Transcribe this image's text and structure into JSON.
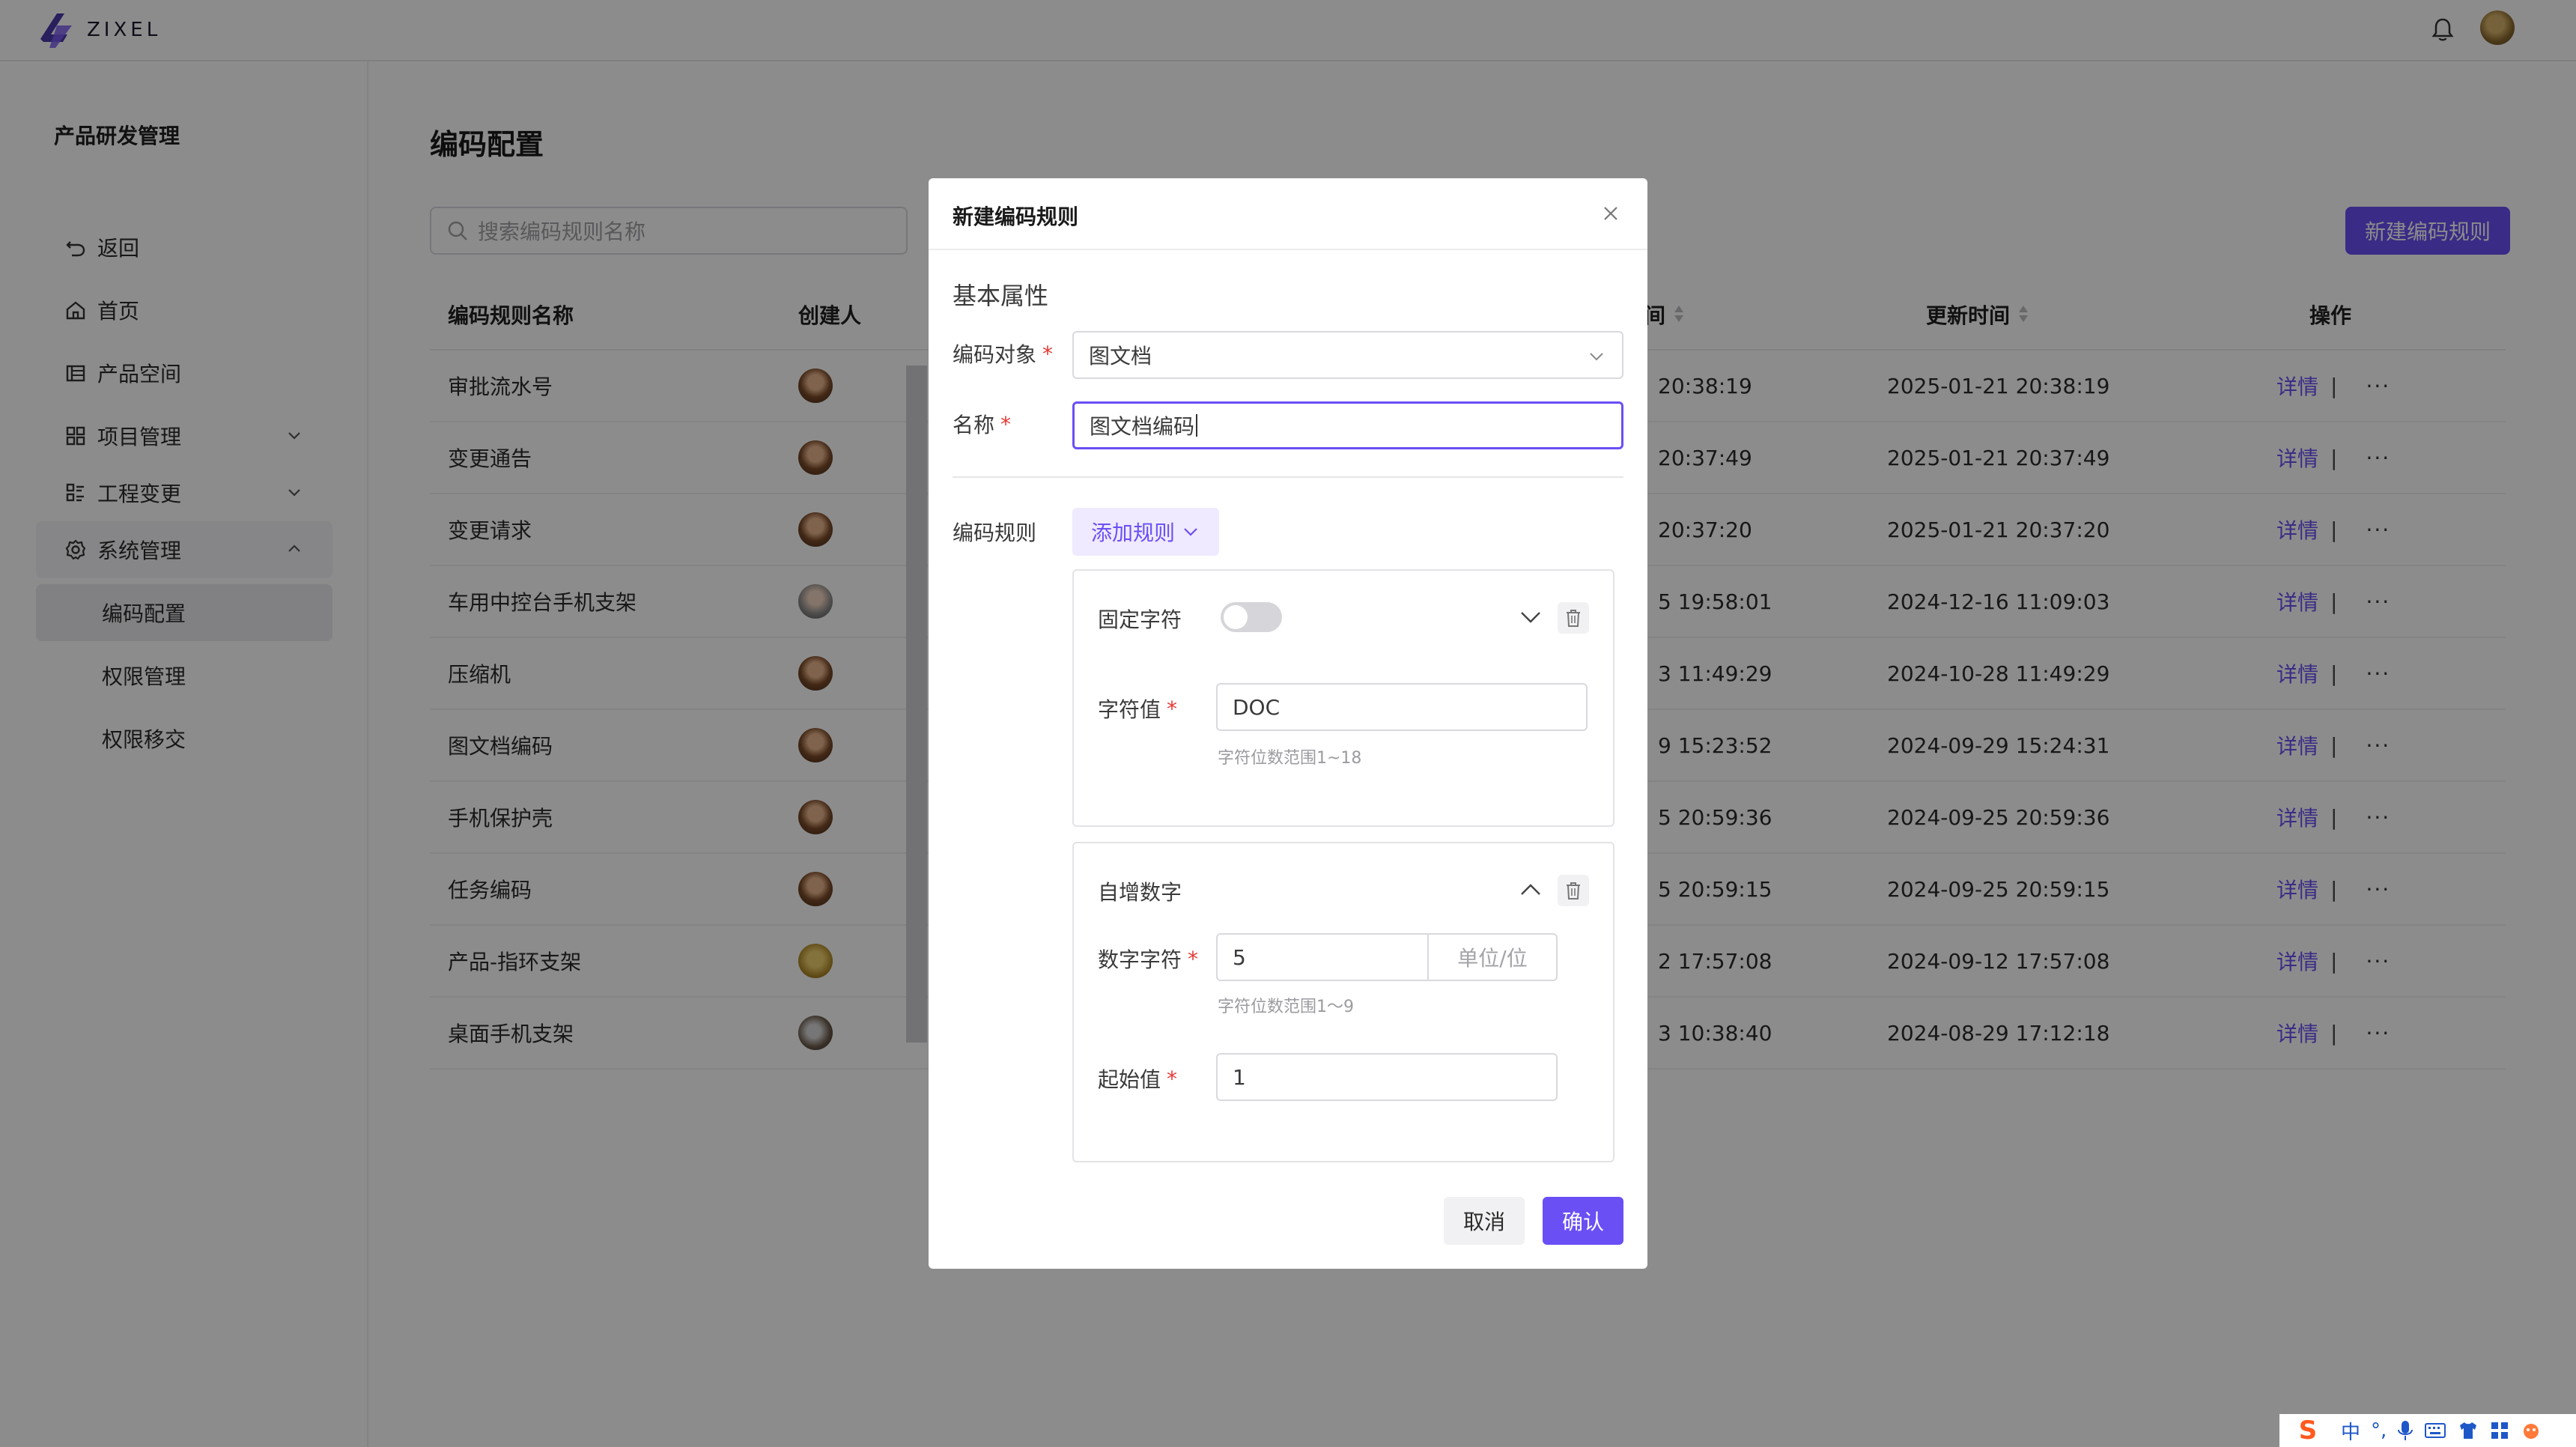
{
  "app": {
    "brand": "ZIXEL"
  },
  "sidebar": {
    "title": "产品研发管理",
    "items": [
      {
        "label": "返回",
        "icon": "undo-icon"
      },
      {
        "label": "首页",
        "icon": "home-icon"
      },
      {
        "label": "产品空间",
        "icon": "library-icon"
      },
      {
        "label": "项目管理",
        "icon": "grid-icon"
      },
      {
        "label": "工程变更",
        "icon": "list-icon"
      },
      {
        "label": "系统管理",
        "icon": "gear-icon"
      }
    ],
    "sub_items": [
      {
        "label": "编码配置"
      },
      {
        "label": "权限管理"
      },
      {
        "label": "权限移交"
      }
    ]
  },
  "main": {
    "title": "编码配置",
    "search_placeholder": "搜索编码规则名称",
    "new_button": "新建编码规则",
    "columns": {
      "name": "编码规则名称",
      "creator": "创建人",
      "ctime_suffix": "间",
      "utime": "更新时间",
      "ops": "操作"
    },
    "rows": [
      {
        "name": "审批流水号",
        "ctime": "20:38:19",
        "utime": "2025-01-21 20:38:19"
      },
      {
        "name": "变更通告",
        "ctime": "20:37:49",
        "utime": "2025-01-21 20:37:49"
      },
      {
        "name": "变更请求",
        "ctime": "20:37:20",
        "utime": "2025-01-21 20:37:20"
      },
      {
        "name": "车用中控台手机支架",
        "ctime": "5 19:58:01",
        "utime": "2024-12-16 11:09:03"
      },
      {
        "name": "压缩机",
        "ctime": "3 11:49:29",
        "utime": "2024-10-28 11:49:29"
      },
      {
        "name": "图文档编码",
        "ctime": "9 15:23:52",
        "utime": "2024-09-29 15:24:31"
      },
      {
        "name": "手机保护壳",
        "ctime": "5 20:59:36",
        "utime": "2024-09-25 20:59:36"
      },
      {
        "name": "任务编码",
        "ctime": "5 20:59:15",
        "utime": "2024-09-25 20:59:15"
      },
      {
        "name": "产品-指环支架",
        "ctime": "2 17:57:08",
        "utime": "2024-09-12 17:57:08"
      },
      {
        "name": "桌面手机支架",
        "ctime": "3 10:38:40",
        "utime": "2024-08-29 17:12:18"
      }
    ],
    "detail_label": "详情",
    "separator": "|",
    "more_label": "···"
  },
  "modal": {
    "title": "新建编码规则",
    "section": "基本属性",
    "target_label": "编码对象",
    "target_value": "图文档",
    "name_label": "名称",
    "name_value": "图文档编码",
    "rule_label": "编码规则",
    "add_rule": "添加规则",
    "required_mark": "*",
    "fixed_card": {
      "title": "固定字符",
      "value_label": "字符值",
      "value": "DOC",
      "hint": "字符位数范围1~18"
    },
    "inc_card": {
      "title": "自增数字",
      "digits_label": "数字字符",
      "digits_value": "5",
      "digits_unit": "单位/位",
      "hint": "字符位数范围1～9",
      "start_label": "起始值",
      "start_value": "1"
    },
    "cancel": "取消",
    "confirm": "确认"
  },
  "ime": {
    "lang": "中",
    "punct": "°,"
  },
  "colors": {
    "accent": "#6a4ff5",
    "required": "#e53935"
  }
}
